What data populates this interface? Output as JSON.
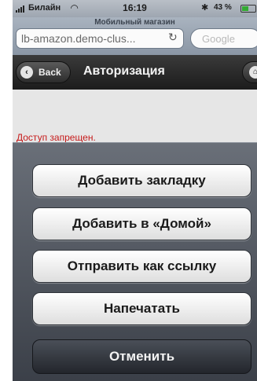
{
  "status_bar": {
    "carrier": "Билайн",
    "time": "16:19",
    "battery": "43 %",
    "battery_level": 0.43
  },
  "browser": {
    "page_title": "Мобильный магазин",
    "url": "lb-amazon.demo-clus...",
    "search_placeholder": "Google"
  },
  "nav": {
    "back_label": "Back",
    "title": "Авторизация"
  },
  "page": {
    "error": "Доступ запрещен."
  },
  "action_sheet": {
    "buttons": [
      "Добавить закладку",
      "Добавить в «Домой»",
      "Отправить как ссылку",
      "Напечатать"
    ],
    "cancel_label": "Отменить"
  },
  "icons": {
    "wifi": "wifi-icon",
    "bluetooth": "bluetooth-icon",
    "reload": "reload-icon",
    "back": "chevron-left-icon",
    "home": "home-icon"
  },
  "colors": {
    "error_red": "#c61a1a",
    "nav_bar": "#1c1c1c",
    "cancel_button": "#2c3037"
  }
}
